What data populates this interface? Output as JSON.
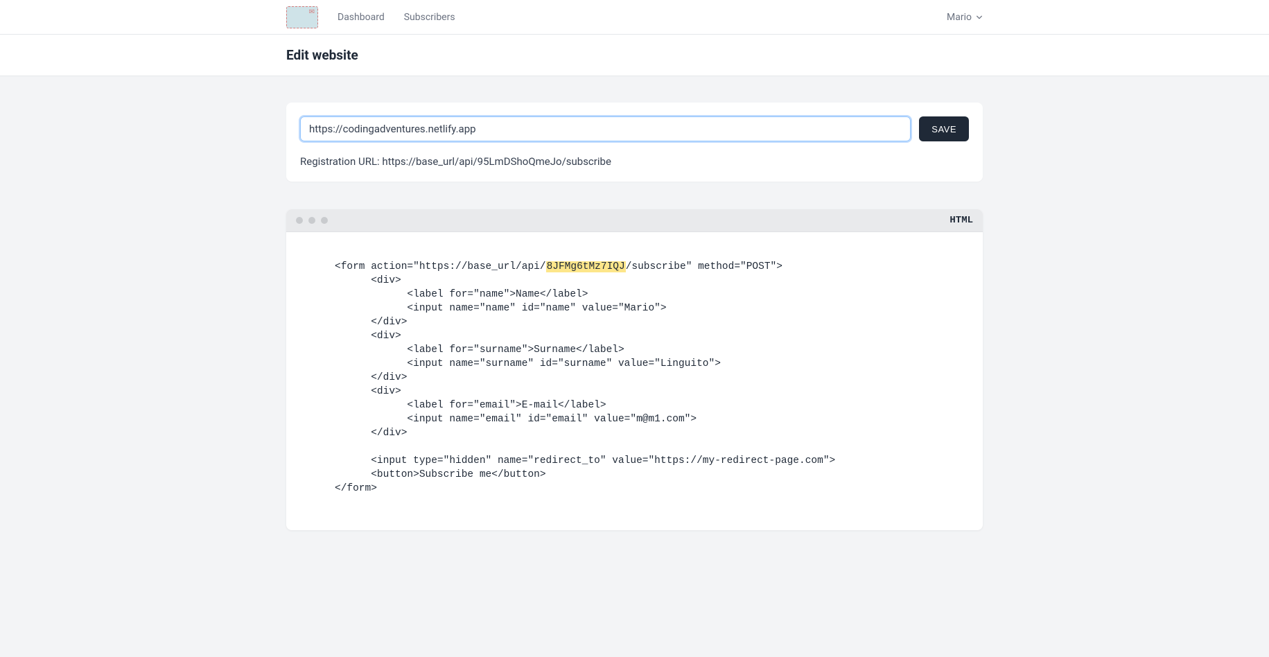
{
  "nav": {
    "dashboard": "Dashboard",
    "subscribers": "Subscribers",
    "user": "Mario"
  },
  "page": {
    "title": "Edit website"
  },
  "form": {
    "url_value": "https://codingadventures.netlify.app",
    "save_label": "SAVE",
    "registration_label": "Registration URL: ",
    "registration_url": "https://base_url/api/95LmDShoQmeJo/subscribe"
  },
  "code": {
    "lang": "HTML",
    "line1_a": "<form action=\"https://base_url/api/",
    "line1_hl": "8JFMg6tMz7IQJ",
    "line1_b": "/subscribe\" method=\"POST\">",
    "line2": "      <div>",
    "line3": "            <label for=\"name\">Name</label>",
    "line4": "            <input name=\"name\" id=\"name\" value=\"Mario\">",
    "line5": "      </div>",
    "line6": "      <div>",
    "line7": "            <label for=\"surname\">Surname</label>",
    "line8": "            <input name=\"surname\" id=\"surname\" value=\"Linguito\">",
    "line9": "      </div>",
    "line10": "      <div>",
    "line11": "            <label for=\"email\">E-mail</label>",
    "line12": "            <input name=\"email\" id=\"email\" value=\"m@m1.com\">",
    "line13": "      </div>",
    "line14": "",
    "line15": "      <input type=\"hidden\" name=\"redirect_to\" value=\"https://my-redirect-page.com\">",
    "line16": "      <button>Subscribe me</button>",
    "line17": "</form>"
  }
}
